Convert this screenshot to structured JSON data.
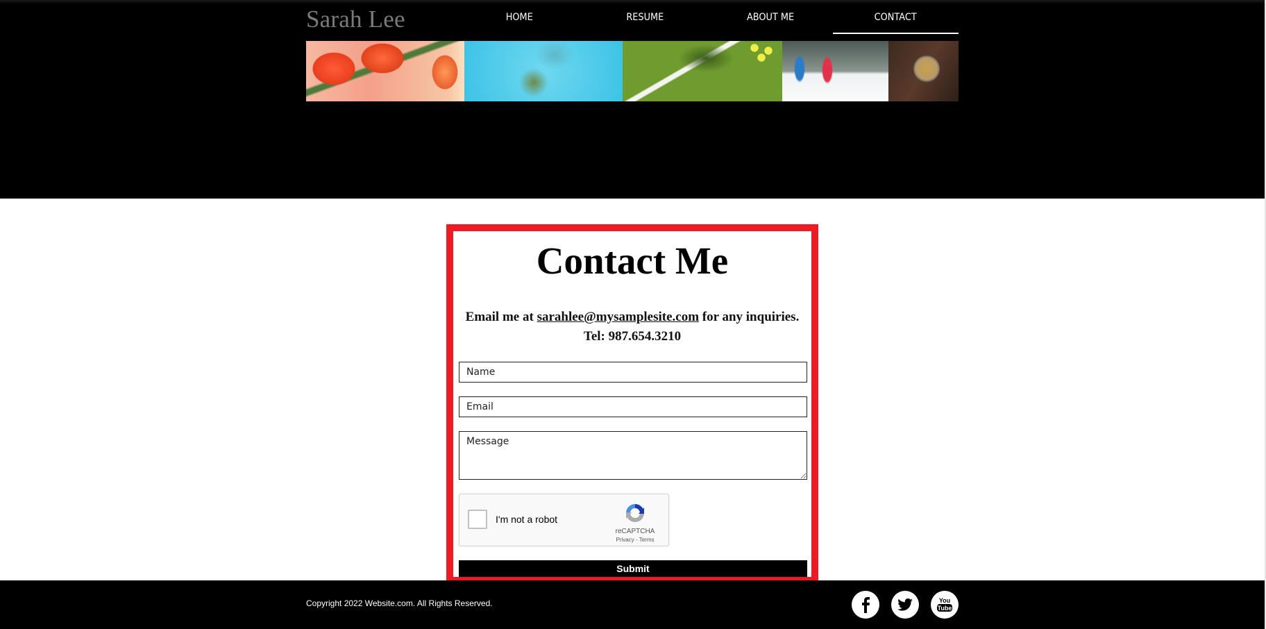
{
  "header": {
    "logo": "Sarah Lee",
    "nav": [
      {
        "label": "HOME",
        "active": false
      },
      {
        "label": "RESUME",
        "active": false
      },
      {
        "label": "ABOUT ME",
        "active": false
      },
      {
        "label": "CONTACT",
        "active": true
      }
    ],
    "photos": [
      "tulips",
      "swimmer",
      "tennis-court",
      "cross-country-skiing",
      "fishing-reel"
    ]
  },
  "contact": {
    "title": "Contact Me",
    "email_prefix": "Email me at ",
    "email": "sarahlee@mysamplesite.com",
    "email_suffix": " for any inquiries.",
    "phone": "Tel: 987.654.3210",
    "form": {
      "name_placeholder": "Name",
      "email_placeholder": "Email",
      "message_placeholder": "Message",
      "captcha_label": "I'm not a robot",
      "captcha_brand": "reCAPTCHA",
      "captcha_links": "Privacy - Terms",
      "submit_label": "Submit"
    },
    "accent_color": "#ed1c24"
  },
  "footer": {
    "copyright": "Copyright 2022 Website.com. All Rights Reserved.",
    "social": [
      "facebook",
      "twitter",
      "youtube"
    ]
  }
}
